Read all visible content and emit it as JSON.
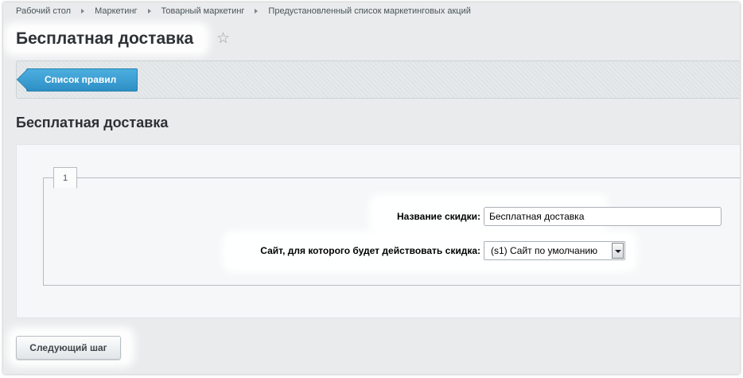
{
  "breadcrumb": {
    "items": [
      "Рабочий стол",
      "Маркетинг",
      "Товарный маркетинг",
      "Предустановленный список маркетинговых акций"
    ]
  },
  "page": {
    "title": "Бесплатная доставка",
    "favorite_icon": "star-icon"
  },
  "toolbar": {
    "rule_list_label": "Список правил"
  },
  "section": {
    "title": "Бесплатная доставка"
  },
  "form": {
    "tab_label": "1",
    "discount_name_label": "Название скидки:",
    "discount_name_value": "Бесплатная доставка",
    "site_label": "Сайт, для которого будет действовать скидка:",
    "site_selected": "(s1) Сайт по умолчанию"
  },
  "footer": {
    "next_step_label": "Следующий шаг"
  },
  "colors": {
    "accent": "#2d8fc4",
    "background": "#e9ebec"
  }
}
